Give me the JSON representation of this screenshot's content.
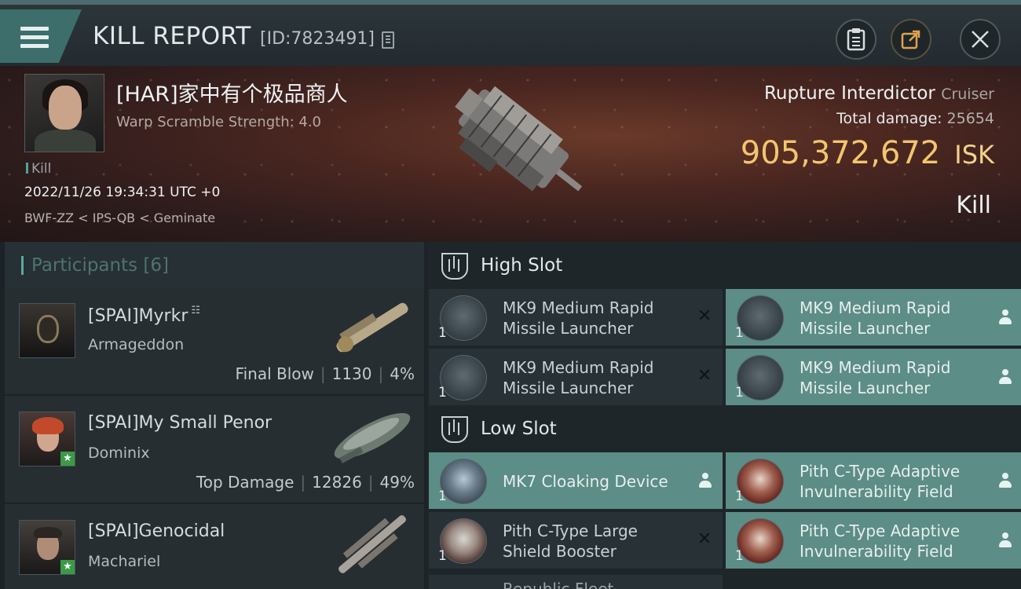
{
  "header": {
    "title": "KILL REPORT",
    "report_id": "[ID:7823491]",
    "menu_icon": "hamburger-menu-icon",
    "buttons": [
      "clipboard-icon",
      "share-icon",
      "close-icon"
    ]
  },
  "victim": {
    "name": "[HAR]家中有个极品商人",
    "detail": "Warp Scramble Strength: 4.0",
    "tag": "Kill",
    "datetime": "2022/11/26 19:34:31 UTC +0",
    "location": "BWF-ZZ < IPS-QB < Geminate",
    "ship_name": "Rupture Interdictor",
    "ship_class": "Cruiser",
    "total_damage_label": "Total damage:",
    "total_damage": "25654",
    "isk_value": "905,372,672",
    "isk_unit": "ISK",
    "result": "Kill"
  },
  "participants": {
    "title": "Participants [6]",
    "rows": [
      {
        "name": "[SPAI]Myrkr",
        "ship": "Armageddon",
        "role": "Final Blow",
        "damage": "1130",
        "percent": "4%",
        "starred": false,
        "fleet_icon": true
      },
      {
        "name": "[SPAI]My Small Penor",
        "ship": "Dominix",
        "role": "Top Damage",
        "damage": "12826",
        "percent": "49%",
        "starred": true,
        "fleet_icon": false
      },
      {
        "name": "[SPAI]Genocidal",
        "ship": "Machariel",
        "role": "",
        "damage": "",
        "percent": "",
        "starred": true,
        "fleet_icon": false
      }
    ]
  },
  "high_slot": {
    "title": "High Slot",
    "modules": [
      {
        "name": "MK9 Medium Rapid Missile Launcher",
        "qty": "1",
        "status": "destroyed",
        "icon": "missile-launcher-icon"
      },
      {
        "name": "MK9 Medium Rapid Missile Launcher",
        "qty": "1",
        "status": "dropped",
        "icon": "missile-launcher-icon"
      },
      {
        "name": "MK9 Medium Rapid Missile Launcher",
        "qty": "1",
        "status": "destroyed",
        "icon": "missile-launcher-icon"
      },
      {
        "name": "MK9 Medium Rapid Missile Launcher",
        "qty": "1",
        "status": "dropped",
        "icon": "missile-launcher-icon"
      }
    ]
  },
  "low_slot": {
    "title": "Low Slot",
    "modules": [
      {
        "name": "MK7 Cloaking Device",
        "qty": "1",
        "status": "dropped",
        "icon": "cloaking-device-icon"
      },
      {
        "name": "Pith C-Type Adaptive Invulnerability Field",
        "qty": "1",
        "status": "dropped",
        "icon": "invulnerability-field-icon"
      },
      {
        "name": "Pith C-Type Large Shield Booster",
        "qty": "1",
        "status": "destroyed",
        "icon": "shield-booster-icon"
      },
      {
        "name": "Pith C-Type Adaptive Invulnerability Field",
        "qty": "1",
        "status": "dropped",
        "icon": "invulnerability-field-icon"
      }
    ],
    "partial_next": "Republic Fleet"
  },
  "colors": {
    "accent": "#5c8d87",
    "isk": "#f2c66e",
    "banner": "#4a2620"
  }
}
